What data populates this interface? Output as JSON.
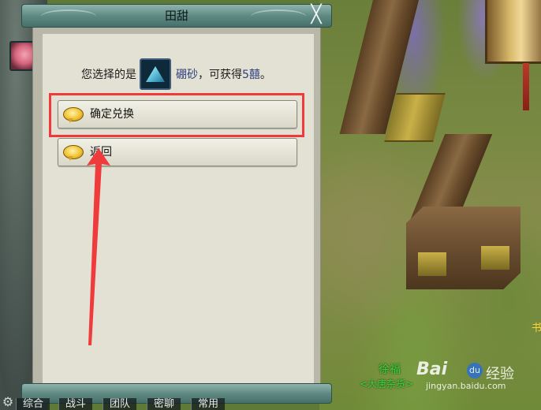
{
  "dialog": {
    "title": "田甜",
    "close_glyph": "╳",
    "prompt_prefix": "您选择的是",
    "item_icon": "borax-crystal-icon",
    "item_name": "硼砂",
    "prompt_middle": "，可获得",
    "amount": "5囍",
    "prompt_suffix": "。",
    "options": [
      {
        "label": "确定兑换",
        "icon": "speech-bubble-icon"
      },
      {
        "label": "返回",
        "icon": "speech-bubble-icon"
      }
    ]
  },
  "chat_tabs": [
    "综合",
    "战斗",
    "团队",
    "密聊",
    "常用"
  ],
  "npc": {
    "name": "徐福",
    "title": "<大唐杂货>"
  },
  "edge_text": "书",
  "watermark": {
    "main": "Bai",
    "paw": "du",
    "tail": "经验",
    "url": "jingyan.baidu.com"
  },
  "colors": {
    "highlight": "#f03a3a",
    "item_name": "#2d3f7a",
    "npc_text": "#3ed23e"
  }
}
